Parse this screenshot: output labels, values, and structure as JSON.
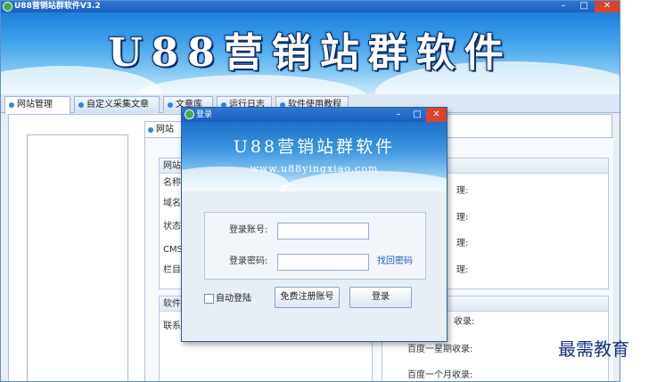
{
  "app": {
    "title": "U88营销站群软件V3.2",
    "banner_title": "U88营销站群软件",
    "window_buttons": {
      "minimize": "–",
      "maximize": "□",
      "close": "✕"
    }
  },
  "tabs": [
    {
      "label": "网站管理",
      "active": true
    },
    {
      "label": "自定义采集文章",
      "active": false
    },
    {
      "label": "文章库",
      "active": false
    },
    {
      "label": "运行日志",
      "active": false
    },
    {
      "label": "软件使用教程",
      "active": false
    }
  ],
  "panel": {
    "inner_tab": "网站",
    "site_group_title": "网站",
    "site_fields": [
      "名称",
      "域名",
      "状态",
      "CMS类",
      "栏目"
    ],
    "manage_labels": [
      "理:",
      "理:",
      "理:",
      "理:"
    ],
    "software_group_title": "软件",
    "software_label": "联系",
    "stats_labels": [
      "收录:",
      "百度一星期收录:",
      "百度一个月收录:"
    ]
  },
  "login_dialog": {
    "title": "登录",
    "banner_title": "U88营销站群软件",
    "banner_url": "www.u88yingxiao.com",
    "account_label": "登录账号:",
    "account_value": "",
    "password_label": "登录密码:",
    "password_value": "",
    "forgot_link": "找回密码",
    "auto_login_label": "自动登陆",
    "auto_login_checked": false,
    "register_button": "免费注册账号",
    "login_button": "登录"
  },
  "watermark": "最需教育",
  "colors": {
    "titlebar": "#1a5fbe",
    "close_button": "#d9432f",
    "accent_blue": "#2d86e0",
    "watermark": "#17317d"
  }
}
